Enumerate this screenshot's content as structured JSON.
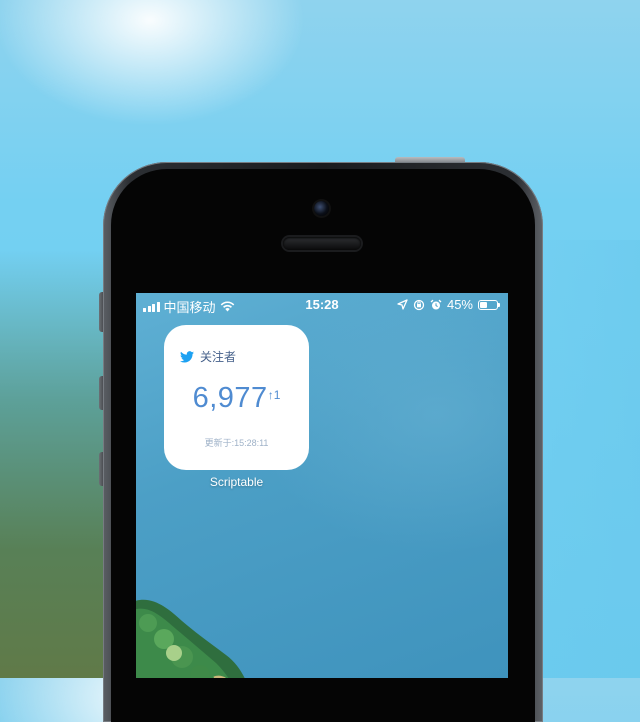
{
  "status_bar": {
    "carrier": "中国移动",
    "time": "15:28",
    "battery_percent": "45%",
    "battery_level": 0.45,
    "icons": [
      "signal-bars-icon",
      "wifi-icon",
      "location-arrow-icon",
      "rotation-lock-icon",
      "alarm-icon",
      "battery-icon"
    ]
  },
  "widget": {
    "icon": "twitter-bird-icon",
    "title": "关注者",
    "count": "6,977",
    "delta": "↑1",
    "updated": "更新于:15:28:11",
    "app_label": "Scriptable",
    "accent_color": "#4f8bd1"
  }
}
